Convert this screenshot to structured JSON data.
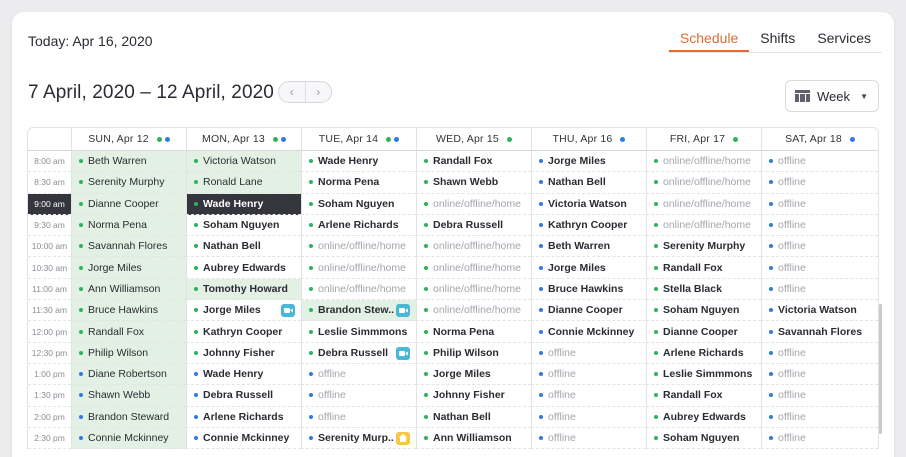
{
  "header": {
    "today": "Today: Apr 16, 2020"
  },
  "tabs": [
    {
      "label": "Schedule",
      "active": true
    },
    {
      "label": "Shifts",
      "active": false
    },
    {
      "label": "Services",
      "active": false
    }
  ],
  "range": {
    "label": "7 April, 2020 – 12 April, 2020",
    "prev": "‹",
    "next": "›"
  },
  "view_select": {
    "label": "Week",
    "icon": "grid-calendar-icon",
    "caret": "▼"
  },
  "colors": {
    "green": "#2fb35a",
    "blue": "#2f7be5",
    "accent": "#e06d34",
    "video_badge": "#49b7d8",
    "note_badge": "#f6c646"
  },
  "days": [
    {
      "label": "SUN, Apr 12",
      "dots": [
        "green",
        "blue"
      ]
    },
    {
      "label": "MON, Apr 13",
      "dots": [
        "green",
        "blue"
      ]
    },
    {
      "label": "TUE, Apr 14",
      "dots": [
        "green",
        "blue"
      ]
    },
    {
      "label": "WED, Apr 15",
      "dots": [
        "green"
      ]
    },
    {
      "label": "THU, Apr 16",
      "dots": [
        "blue"
      ]
    },
    {
      "label": "FRI, Apr 17",
      "dots": [
        "green"
      ]
    },
    {
      "label": "SAT, Apr 18",
      "dots": [
        "blue"
      ]
    }
  ],
  "times": [
    "8:00 am",
    "8:30 am",
    "9:00 am",
    "9:30 am",
    "10:00 am",
    "10:30 am",
    "11:00 am",
    "11:30 am",
    "12:00 pm",
    "12:30 pm",
    "1:00 pm",
    "1:30 pm",
    "2:00 pm",
    "2:30 pm"
  ],
  "rows": [
    [
      {
        "t": "Beth Warren",
        "c": "green",
        "s": "g"
      },
      {
        "t": "Victoria Watson",
        "c": "green",
        "s": "g"
      },
      {
        "t": "Wade Henry",
        "c": "green",
        "s": "b"
      },
      {
        "t": "Randall Fox",
        "c": "green",
        "s": "b"
      },
      {
        "t": "Jorge Miles",
        "c": "blue",
        "s": "b"
      },
      {
        "t": "online/offline/home",
        "c": "green",
        "s": "l"
      },
      {
        "t": "offline",
        "c": "blue",
        "s": "l"
      }
    ],
    [
      {
        "t": "Serenity Murphy",
        "c": "green",
        "s": "g"
      },
      {
        "t": "Ronald Lane",
        "c": "green",
        "s": "g"
      },
      {
        "t": "Norma Pena",
        "c": "green",
        "s": "b"
      },
      {
        "t": "Shawn Webb",
        "c": "green",
        "s": "b"
      },
      {
        "t": "Nathan Bell",
        "c": "blue",
        "s": "b"
      },
      {
        "t": "online/offline/home",
        "c": "green",
        "s": "l"
      },
      {
        "t": "offline",
        "c": "blue",
        "s": "l"
      }
    ],
    [
      {
        "t": "Dianne Cooper",
        "c": "green",
        "s": "g"
      },
      {
        "t": "Wade Henry",
        "c": "green",
        "s": "d"
      },
      {
        "t": "Soham Nguyen",
        "c": "green",
        "s": "b"
      },
      {
        "t": "online/offline/home",
        "c": "green",
        "s": "l"
      },
      {
        "t": "Victoria Watson",
        "c": "blue",
        "s": "b"
      },
      {
        "t": "online/offline/home",
        "c": "green",
        "s": "l"
      },
      {
        "t": "offline",
        "c": "blue",
        "s": "l"
      }
    ],
    [
      {
        "t": "Norma Pena",
        "c": "green",
        "s": "g"
      },
      {
        "t": "Soham Nguyen",
        "c": "green",
        "s": "b"
      },
      {
        "t": "Arlene Richards",
        "c": "green",
        "s": "b"
      },
      {
        "t": "Debra Russell",
        "c": "green",
        "s": "b"
      },
      {
        "t": "Kathryn Cooper",
        "c": "blue",
        "s": "b"
      },
      {
        "t": "online/offline/home",
        "c": "green",
        "s": "l"
      },
      {
        "t": "offline",
        "c": "blue",
        "s": "l"
      }
    ],
    [
      {
        "t": "Savannah Flores",
        "c": "green",
        "s": "g"
      },
      {
        "t": "Nathan Bell",
        "c": "green",
        "s": "b"
      },
      {
        "t": "online/offline/home",
        "c": "green",
        "s": "l"
      },
      {
        "t": "online/offline/home",
        "c": "green",
        "s": "l"
      },
      {
        "t": "Beth Warren",
        "c": "blue",
        "s": "b"
      },
      {
        "t": "Serenity Murphy",
        "c": "green",
        "s": "b"
      },
      {
        "t": "offline",
        "c": "blue",
        "s": "l"
      }
    ],
    [
      {
        "t": "Jorge Miles",
        "c": "green",
        "s": "g"
      },
      {
        "t": "Aubrey Edwards",
        "c": "green",
        "s": "b"
      },
      {
        "t": "online/offline/home",
        "c": "green",
        "s": "l"
      },
      {
        "t": "online/offline/home",
        "c": "green",
        "s": "l"
      },
      {
        "t": "Jorge Miles",
        "c": "blue",
        "s": "b"
      },
      {
        "t": "Randall Fox",
        "c": "green",
        "s": "b"
      },
      {
        "t": "offline",
        "c": "blue",
        "s": "l"
      }
    ],
    [
      {
        "t": "Ann Williamson",
        "c": "green",
        "s": "g"
      },
      {
        "t": "Tomothy Howard",
        "c": "green",
        "s": "gb"
      },
      {
        "t": "online/offline/home",
        "c": "green",
        "s": "l"
      },
      {
        "t": "online/offline/home",
        "c": "green",
        "s": "l"
      },
      {
        "t": "Bruce Hawkins",
        "c": "blue",
        "s": "b"
      },
      {
        "t": "Stella Black",
        "c": "green",
        "s": "b"
      },
      {
        "t": "offline",
        "c": "blue",
        "s": "l"
      }
    ],
    [
      {
        "t": "Bruce Hawkins",
        "c": "green",
        "s": "g"
      },
      {
        "t": "Jorge Miles",
        "c": "green",
        "s": "b",
        "badge": "video"
      },
      {
        "t": "Brandon Stew..",
        "c": "green",
        "s": "gb",
        "badge": "video"
      },
      {
        "t": "online/offline/home",
        "c": "green",
        "s": "l"
      },
      {
        "t": "Dianne Cooper",
        "c": "blue",
        "s": "b"
      },
      {
        "t": "Soham Nguyen",
        "c": "green",
        "s": "b"
      },
      {
        "t": "Victoria Watson",
        "c": "blue",
        "s": "b"
      }
    ],
    [
      {
        "t": "Randall Fox",
        "c": "green",
        "s": "g"
      },
      {
        "t": "Kathryn Cooper",
        "c": "green",
        "s": "b"
      },
      {
        "t": "Leslie Simmmons",
        "c": "green",
        "s": "b"
      },
      {
        "t": "Norma Pena",
        "c": "green",
        "s": "b"
      },
      {
        "t": "Connie Mckinney",
        "c": "blue",
        "s": "b"
      },
      {
        "t": "Dianne Cooper",
        "c": "green",
        "s": "b"
      },
      {
        "t": "Savannah Flores",
        "c": "blue",
        "s": "b"
      }
    ],
    [
      {
        "t": "Philip Wilson",
        "c": "green",
        "s": "g"
      },
      {
        "t": "Johnny Fisher",
        "c": "green",
        "s": "b"
      },
      {
        "t": "Debra Russell",
        "c": "green",
        "s": "b",
        "badge": "video"
      },
      {
        "t": "Philip Wilson",
        "c": "green",
        "s": "b"
      },
      {
        "t": "offline",
        "c": "blue",
        "s": "l"
      },
      {
        "t": "Arlene Richards",
        "c": "green",
        "s": "b"
      },
      {
        "t": "offline",
        "c": "blue",
        "s": "l"
      }
    ],
    [
      {
        "t": "Diane Robertson",
        "c": "blue",
        "s": "g"
      },
      {
        "t": "Wade Henry",
        "c": "blue",
        "s": "b"
      },
      {
        "t": "offline",
        "c": "blue",
        "s": "l"
      },
      {
        "t": "Jorge Miles",
        "c": "green",
        "s": "b"
      },
      {
        "t": "offline",
        "c": "blue",
        "s": "l"
      },
      {
        "t": "Leslie Simmmons",
        "c": "green",
        "s": "b"
      },
      {
        "t": "offline",
        "c": "blue",
        "s": "l"
      }
    ],
    [
      {
        "t": "Shawn Webb",
        "c": "blue",
        "s": "g"
      },
      {
        "t": "Debra Russell",
        "c": "blue",
        "s": "b"
      },
      {
        "t": "offline",
        "c": "blue",
        "s": "l"
      },
      {
        "t": "Johnny Fisher",
        "c": "green",
        "s": "b"
      },
      {
        "t": "offline",
        "c": "blue",
        "s": "l"
      },
      {
        "t": "Randall Fox",
        "c": "green",
        "s": "b"
      },
      {
        "t": "offline",
        "c": "blue",
        "s": "l"
      }
    ],
    [
      {
        "t": "Brandon Steward",
        "c": "blue",
        "s": "g"
      },
      {
        "t": "Arlene Richards",
        "c": "blue",
        "s": "b"
      },
      {
        "t": "offline",
        "c": "blue",
        "s": "l"
      },
      {
        "t": "Nathan Bell",
        "c": "green",
        "s": "b"
      },
      {
        "t": "offline",
        "c": "blue",
        "s": "l"
      },
      {
        "t": "Aubrey Edwards",
        "c": "green",
        "s": "b"
      },
      {
        "t": "offline",
        "c": "blue",
        "s": "l"
      }
    ],
    [
      {
        "t": "Connie Mckinney",
        "c": "blue",
        "s": "g"
      },
      {
        "t": "Connie Mckinney",
        "c": "blue",
        "s": "b"
      },
      {
        "t": "Serenity Murp..",
        "c": "blue",
        "s": "b",
        "badge": "note"
      },
      {
        "t": "Ann Williamson",
        "c": "green",
        "s": "b"
      },
      {
        "t": "offline",
        "c": "blue",
        "s": "l"
      },
      {
        "t": "Soham Nguyen",
        "c": "green",
        "s": "b"
      },
      {
        "t": "offline",
        "c": "blue",
        "s": "l"
      }
    ]
  ],
  "highlight_time_index": 2
}
